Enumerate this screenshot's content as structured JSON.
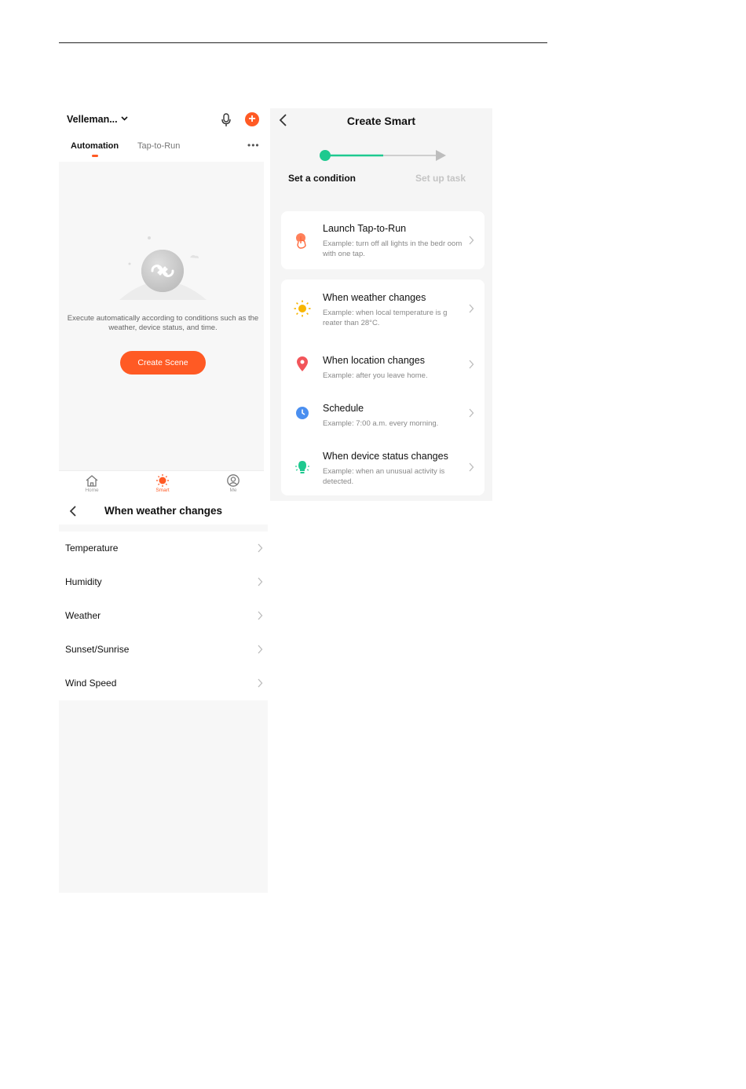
{
  "smart_home": {
    "home_name": "Velleman...",
    "tabs": [
      {
        "label": "Automation",
        "active": true
      },
      {
        "label": "Tap-to-Run",
        "active": false
      }
    ],
    "empty_state": {
      "message": "Execute automatically according to conditions such as the weather, device status, and time.",
      "button_label": "Create Scene"
    },
    "bottom_nav": [
      {
        "label": "Home",
        "icon": "home-icon",
        "active": false
      },
      {
        "label": "Smart",
        "icon": "smart-sun-icon",
        "active": true
      },
      {
        "label": "Me",
        "icon": "profile-icon",
        "active": false
      }
    ],
    "accent_color": "#ff5a24"
  },
  "create_smart": {
    "title": "Create Smart",
    "steps": [
      {
        "label": "Set a condition",
        "active": true
      },
      {
        "label": "Set up task",
        "active": false
      }
    ],
    "step_color": "#1ec98f",
    "conditions": [
      {
        "title": "Launch Tap-to-Run",
        "desc": "Example: turn off all lights in the bedr oom with one tap.",
        "icon": "tap-hand-icon"
      },
      {
        "title": "When weather changes",
        "desc": "Example: when local temperature is g reater than 28°C.",
        "icon": "sun-icon"
      },
      {
        "title": "When location changes",
        "desc": "Example: after you leave home.",
        "icon": "location-pin-icon"
      },
      {
        "title": "Schedule",
        "desc": "Example: 7:00 a.m. every morning.",
        "icon": "clock-icon"
      },
      {
        "title": "When device status changes",
        "desc": "Example: when an unusual activity is detected.",
        "icon": "device-bulb-icon"
      }
    ]
  },
  "weather_changes": {
    "title": "When weather changes",
    "items": [
      "Temperature",
      "Humidity",
      "Weather",
      "Sunset/Sunrise",
      "Wind Speed"
    ]
  }
}
